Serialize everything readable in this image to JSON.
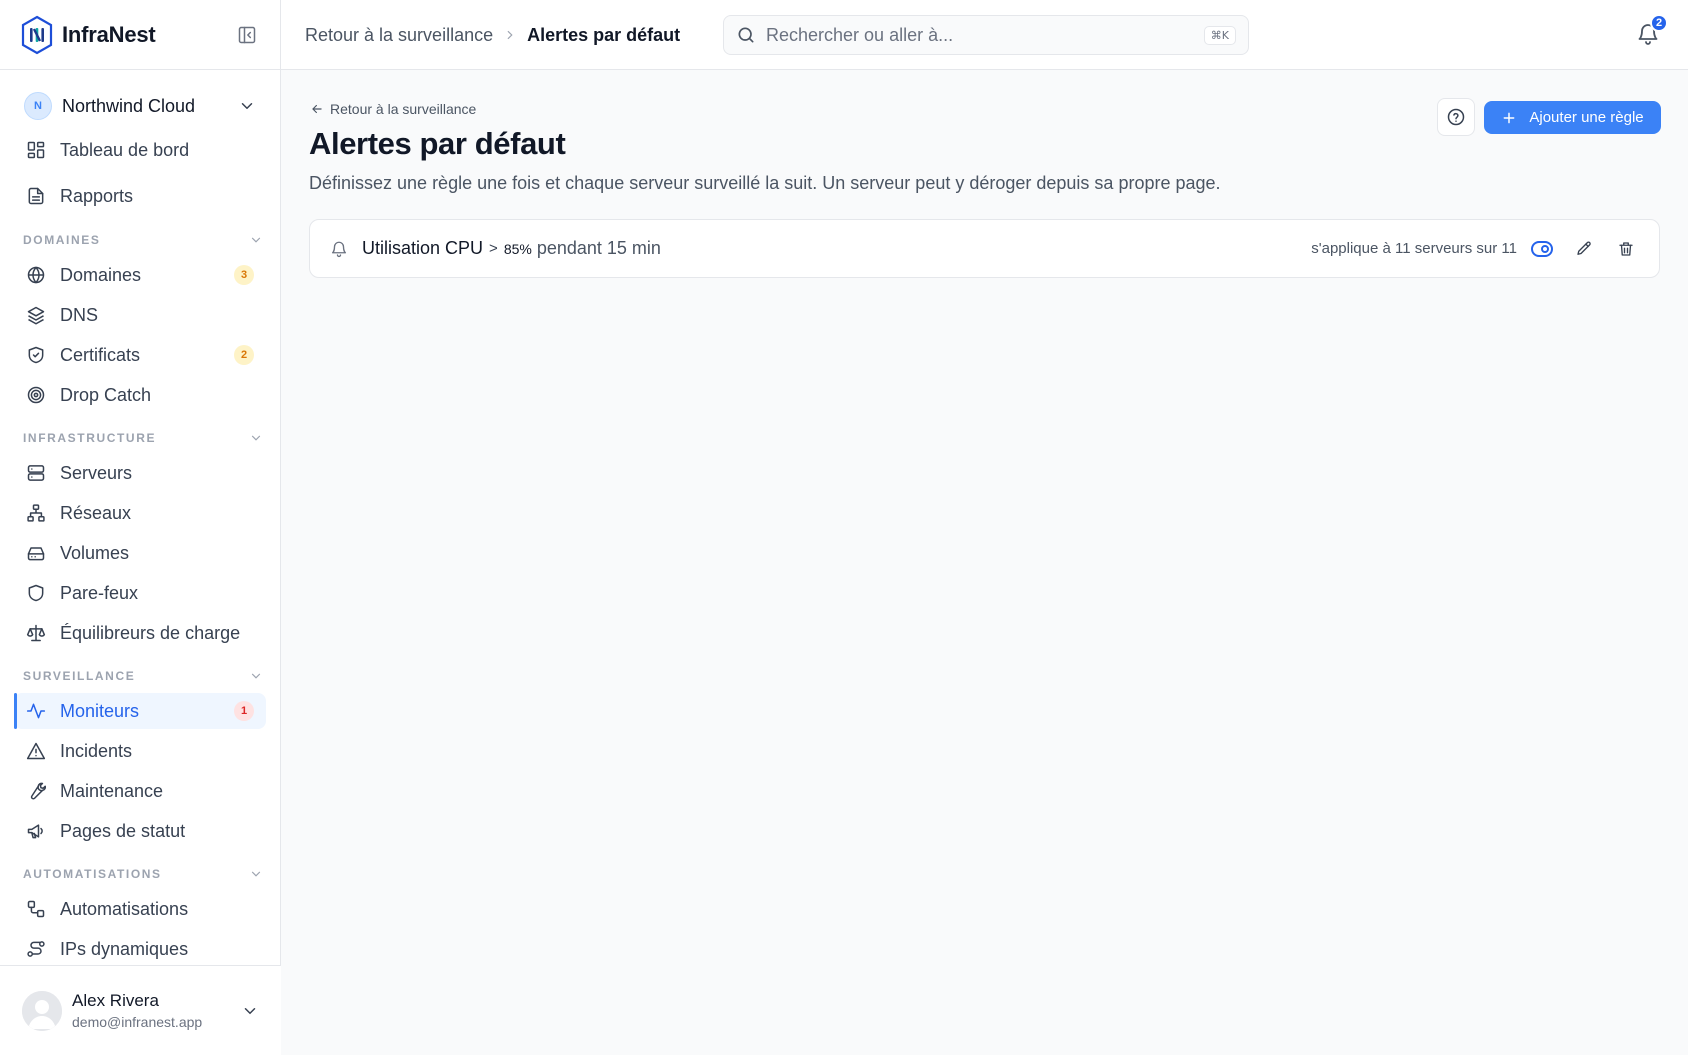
{
  "brand": {
    "name": "InfraNest"
  },
  "org": {
    "initial": "N",
    "name": "Northwind Cloud"
  },
  "nav": {
    "top": [
      {
        "label": "Tableau de bord",
        "icon": "dashboard-icon"
      },
      {
        "label": "Rapports",
        "icon": "document-icon"
      }
    ],
    "sections": [
      {
        "title": "DOMAINES",
        "items": [
          {
            "label": "Domaines",
            "icon": "globe-icon",
            "badge": "3",
            "badge_color": "amber"
          },
          {
            "label": "DNS",
            "icon": "layers-icon"
          },
          {
            "label": "Certificats",
            "icon": "shield-check-icon",
            "badge": "2",
            "badge_color": "amber"
          },
          {
            "label": "Drop Catch",
            "icon": "target-icon"
          }
        ]
      },
      {
        "title": "INFRASTRUCTURE",
        "items": [
          {
            "label": "Serveurs",
            "icon": "server-icon"
          },
          {
            "label": "Réseaux",
            "icon": "network-icon"
          },
          {
            "label": "Volumes",
            "icon": "hard-drive-icon"
          },
          {
            "label": "Pare-feux",
            "icon": "shield-icon"
          },
          {
            "label": "Équilibreurs de charge",
            "icon": "scale-icon"
          }
        ]
      },
      {
        "title": "SURVEILLANCE",
        "items": [
          {
            "label": "Moniteurs",
            "icon": "activity-icon",
            "badge": "1",
            "badge_color": "red",
            "active": true
          },
          {
            "label": "Incidents",
            "icon": "alert-triangle-icon"
          },
          {
            "label": "Maintenance",
            "icon": "wrench-icon"
          },
          {
            "label": "Pages de statut",
            "icon": "megaphone-icon"
          }
        ]
      },
      {
        "title": "AUTOMATISATIONS",
        "items": [
          {
            "label": "Automatisations",
            "icon": "workflow-icon"
          },
          {
            "label": "IPs dynamiques",
            "icon": "route-icon"
          }
        ]
      }
    ]
  },
  "user": {
    "name": "Alex Rivera",
    "email": "demo@infranest.app"
  },
  "topbar": {
    "breadcrumb_parent": "Retour à la surveillance",
    "breadcrumb_current": "Alertes par défaut",
    "search_placeholder": "Rechercher ou aller à...",
    "search_shortcut": "⌘K",
    "notification_count": "2"
  },
  "page": {
    "back_label": "Retour à la surveillance",
    "title": "Alertes par défaut",
    "description": "Définissez une règle une fois et chaque serveur surveillé la suit. Un serveur peut y déroger depuis sa propre page.",
    "add_button": "Ajouter une règle"
  },
  "rules": [
    {
      "metric": "Utilisation CPU",
      "operator": ">",
      "threshold": "85%",
      "duration": "pendant 15 min",
      "applies": "s'applique à 11 serveurs sur 11",
      "enabled": true
    }
  ],
  "colors": {
    "accent": "#3b82f6",
    "badge_amber": "#d97706",
    "badge_red": "#dc2626"
  }
}
